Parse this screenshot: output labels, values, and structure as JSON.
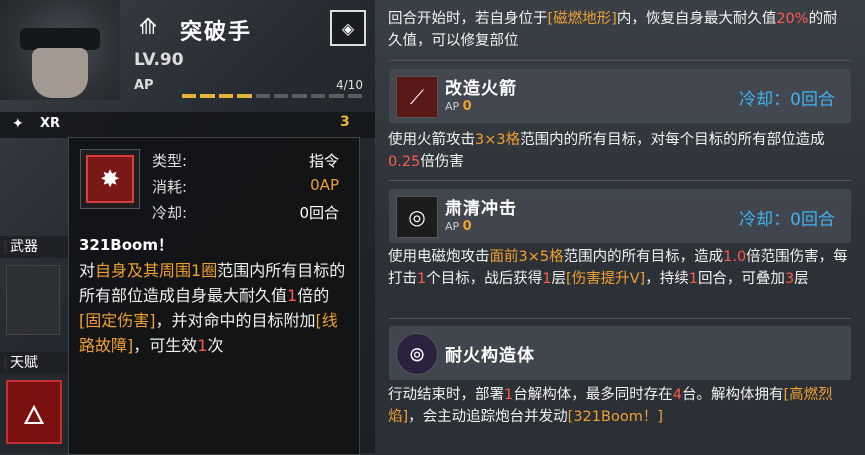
{
  "unit": {
    "name": "突破手",
    "level": "LV.90",
    "ap_label": "AP",
    "ap_count": "4/10",
    "ap_fraction": 0.4,
    "xr_label": "XR",
    "xr_value": "3"
  },
  "sidebar": {
    "weapon_label": "武器",
    "talent_label": "天赋"
  },
  "tooltip": {
    "type_label": "类型:",
    "type_value": "指令",
    "cost_label": "消耗:",
    "cost_value": "0AP",
    "cooldown_label": "冷却:",
    "cooldown_value": "0回合",
    "title": "321Boom！",
    "desc_parts": [
      {
        "t": "对",
        "c": ""
      },
      {
        "t": "自身及其周围1圈",
        "c": "o"
      },
      {
        "t": "范围内所有目标的所有部位造成自身最大耐久值",
        "c": ""
      },
      {
        "t": "1",
        "c": "r"
      },
      {
        "t": "倍的",
        "c": ""
      },
      {
        "t": "[固定伤害]",
        "c": "o"
      },
      {
        "t": "，并对命中的目标附加",
        "c": ""
      },
      {
        "t": "[线路故障]",
        "c": "o"
      },
      {
        "t": "，可生效",
        "c": ""
      },
      {
        "t": "1",
        "c": "r"
      },
      {
        "t": "次",
        "c": ""
      }
    ]
  },
  "passive_top": {
    "desc_parts": [
      {
        "t": "回合开始时，若自身位于",
        "c": ""
      },
      {
        "t": "[磁燃地形]",
        "c": "o"
      },
      {
        "t": "内，恢复自身最大耐久值",
        "c": ""
      },
      {
        "t": "20%",
        "c": "r"
      },
      {
        "t": "的耐久值，可以修复部位",
        "c": ""
      }
    ]
  },
  "skills": [
    {
      "name": "改造火箭",
      "ap_label": "AP",
      "ap_value": "0",
      "cooldown": "冷却：0回合",
      "icon": "rocket-icon",
      "desc_parts": [
        {
          "t": "使用火箭攻击",
          "c": ""
        },
        {
          "t": "3×3格",
          "c": "o"
        },
        {
          "t": "范围内的所有目标，对每个目标的所有部位造成",
          "c": ""
        },
        {
          "t": "0.25",
          "c": "r"
        },
        {
          "t": "倍伤害",
          "c": ""
        }
      ]
    },
    {
      "name": "肃清冲击",
      "ap_label": "AP",
      "ap_value": "0",
      "cooldown": "冷却：0回合",
      "icon": "emp-blast-icon",
      "desc_parts": [
        {
          "t": "使用电磁炮攻击",
          "c": ""
        },
        {
          "t": "面前3×5格",
          "c": "o"
        },
        {
          "t": "范围内的所有目标，造成",
          "c": ""
        },
        {
          "t": "1.0",
          "c": "r"
        },
        {
          "t": "倍范围伤害，每打击",
          "c": ""
        },
        {
          "t": "1",
          "c": "r"
        },
        {
          "t": "个目标，战后获得",
          "c": ""
        },
        {
          "t": "1",
          "c": "r"
        },
        {
          "t": "层",
          "c": ""
        },
        {
          "t": "[伤害提升Ⅴ]",
          "c": "o"
        },
        {
          "t": "，持续",
          "c": ""
        },
        {
          "t": "1",
          "c": "r"
        },
        {
          "t": "回合，可叠加",
          "c": ""
        },
        {
          "t": "3",
          "c": "r"
        },
        {
          "t": "层",
          "c": ""
        }
      ]
    },
    {
      "name": "耐火构造体",
      "icon": "construct-icon",
      "desc_parts": [
        {
          "t": "行动结束时，部署",
          "c": ""
        },
        {
          "t": "1",
          "c": "r"
        },
        {
          "t": "台解构体，最多同时存在",
          "c": ""
        },
        {
          "t": "4",
          "c": "r"
        },
        {
          "t": "台。解构体拥有",
          "c": ""
        },
        {
          "t": "[高燃烈焰]",
          "c": "o"
        },
        {
          "t": "，会主动追踪炮台并发动",
          "c": ""
        },
        {
          "t": "[321Boom！]",
          "c": "o"
        }
      ]
    }
  ],
  "colors": {
    "highlight_orange": "#f0a030",
    "highlight_red": "#ff5a4a",
    "cooldown_blue": "#3fb4f0",
    "ap_bar": "#e8b23a"
  }
}
